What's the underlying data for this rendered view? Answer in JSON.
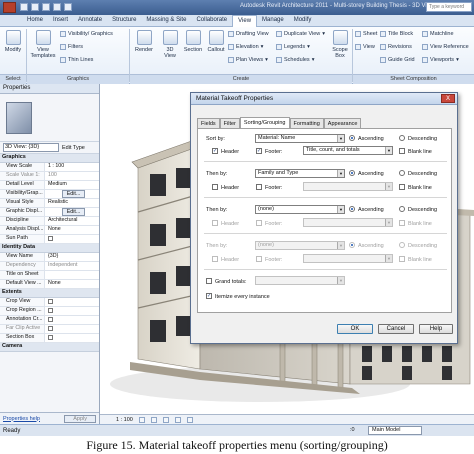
{
  "window": {
    "title": "Autodesk Revit Architecture 2011 - Multi-storey Building Thesis - 3D View",
    "search_placeholder": "Type a keyword"
  },
  "tabs": [
    "Home",
    "Insert",
    "Annotate",
    "Structure",
    "Massing & Site",
    "Collaborate",
    "View",
    "Manage",
    "Modify"
  ],
  "active_tab": "View",
  "ribbon": {
    "modify": "Modify",
    "select": "Select",
    "view_templates": "View Templates",
    "visibility_graphics": "Visibility/ Graphics",
    "filters": "Filters",
    "thin_lines": "Thin Lines",
    "graphics": "Graphics",
    "render": "Render",
    "three_d_view": "3D View",
    "section": "Section",
    "callout": "Callout",
    "drafting_view": "Drafting View",
    "elevation": "Elevation",
    "plan_views": "Plan Views",
    "duplicate_view": "Duplicate View",
    "legends": "Legends",
    "schedules": "Schedules",
    "scope_box": "Scope Box",
    "create": "Create",
    "sheet": "Sheet",
    "title_block": "Title Block",
    "matchline": "Matchline",
    "view": "View",
    "revisions": "Revisions",
    "view_reference": "View Reference",
    "guide_grid": "Guide Grid",
    "viewports": "Viewports",
    "sheet_composition": "Sheet Composition"
  },
  "properties": {
    "title": "Properties",
    "view_selector": "3D View: {3D}",
    "edit_type": "Edit Type",
    "groups": {
      "graphics": "Graphics",
      "identity": "Identity Data",
      "extents": "Extents",
      "camera": "Camera"
    },
    "rows": {
      "view_scale_k": "View Scale",
      "view_scale_v": "1 : 100",
      "scale_value_k": "Scale Value 1:",
      "scale_value_v": "100",
      "detail_level_k": "Detail Level",
      "detail_level_v": "Medium",
      "vis_k": "Visibility/Grap...",
      "vis_v": "Edit...",
      "visual_style_k": "Visual Style",
      "visual_style_v": "Realistic",
      "graphic_disp_k": "Graphic Displ...",
      "graphic_disp_v": "Edit...",
      "discipline_k": "Discipline",
      "discipline_v": "Architectural",
      "analysis_k": "Analysis Displ...",
      "analysis_v": "None",
      "sun_path_k": "Sun Path",
      "view_name_k": "View Name",
      "view_name_v": "{3D}",
      "dependency_k": "Dependency",
      "dependency_v": "Independent",
      "title_sheet_k": "Title on Sheet",
      "default_view_k": "Default View ...",
      "default_view_v": "None",
      "crop_view_k": "Crop View",
      "crop_region_k": "Crop Region ...",
      "annotation_k": "Annotation Cr...",
      "far_clip_k": "Far Clip Active",
      "section_box_k": "Section Box"
    },
    "help_link": "Properties help",
    "apply": "Apply"
  },
  "viewport": {
    "scale": "1 : 100"
  },
  "status": {
    "text": "Ready",
    "zero": ":0",
    "model": "Main Model"
  },
  "dialog": {
    "title": "Material Takeoff Properties",
    "close": "X",
    "tabs": [
      "Fields",
      "Filter",
      "Sorting/Grouping",
      "Formatting",
      "Appearance"
    ],
    "active_tab": "Sorting/Grouping",
    "sort_by": "Sort by:",
    "then_by": "Then by:",
    "sort1_value": "Material: Name",
    "sort2_value": "Family and Type",
    "sort3_value": "(none)",
    "sort4_value": "(none)",
    "ascending": "Ascending",
    "descending": "Descending",
    "header": "Header",
    "footer": "Footer:",
    "footer1_value": "Title, count, and totals",
    "blank_line": "Blank line",
    "grand_totals": "Grand totals:",
    "itemize": "Itemize every instance",
    "ok": "OK",
    "cancel": "Cancel",
    "help": "Help"
  },
  "caption": "Figure 15. Material takeoff properties menu (sorting/grouping)"
}
